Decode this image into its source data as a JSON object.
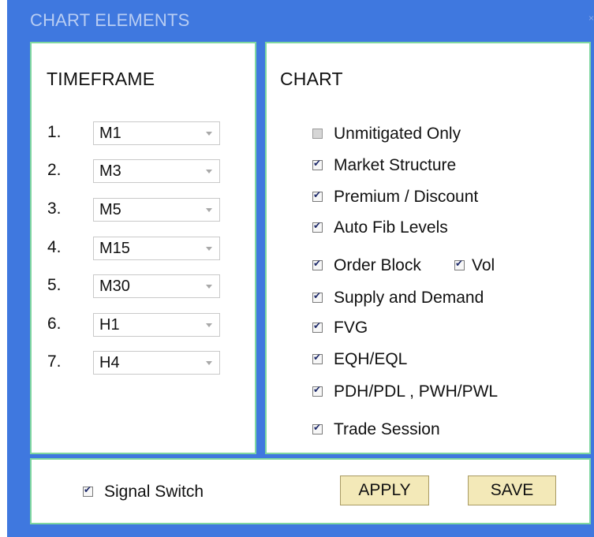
{
  "window": {
    "title": "CHART ELEMENTS",
    "close_glyph": "×"
  },
  "timeframe": {
    "heading": "TIMEFRAME",
    "rows": [
      {
        "num": "1.",
        "value": "M1"
      },
      {
        "num": "2.",
        "value": "M3"
      },
      {
        "num": "3.",
        "value": "M5"
      },
      {
        "num": "4.",
        "value": "M15"
      },
      {
        "num": "5.",
        "value": "M30"
      },
      {
        "num": "6.",
        "value": "H1"
      },
      {
        "num": "7.",
        "value": "H4"
      }
    ]
  },
  "chart": {
    "heading": "CHART",
    "options": [
      {
        "label": "Unmitigated Only",
        "checked": false
      },
      {
        "label": "Market Structure",
        "checked": true
      },
      {
        "label": "Premium / Discount",
        "checked": true
      },
      {
        "label": "Auto Fib Levels",
        "checked": true
      },
      {
        "label": "Order Block",
        "checked": true
      },
      {
        "label": "Vol",
        "checked": true
      },
      {
        "label": "Supply and Demand",
        "checked": true
      },
      {
        "label": "FVG",
        "checked": true
      },
      {
        "label": "EQH/EQL",
        "checked": true
      },
      {
        "label": "PDH/PDL , PWH/PWL",
        "checked": true
      },
      {
        "label": "Trade Session",
        "checked": true
      }
    ]
  },
  "bottom": {
    "signal_switch": {
      "label": "Signal Switch",
      "checked": true
    },
    "apply_label": "APPLY",
    "save_label": "SAVE"
  },
  "colors": {
    "window_bg": "#3f78df",
    "panel_border": "#7fd7a0",
    "button_bg": "#f3e9b8"
  }
}
